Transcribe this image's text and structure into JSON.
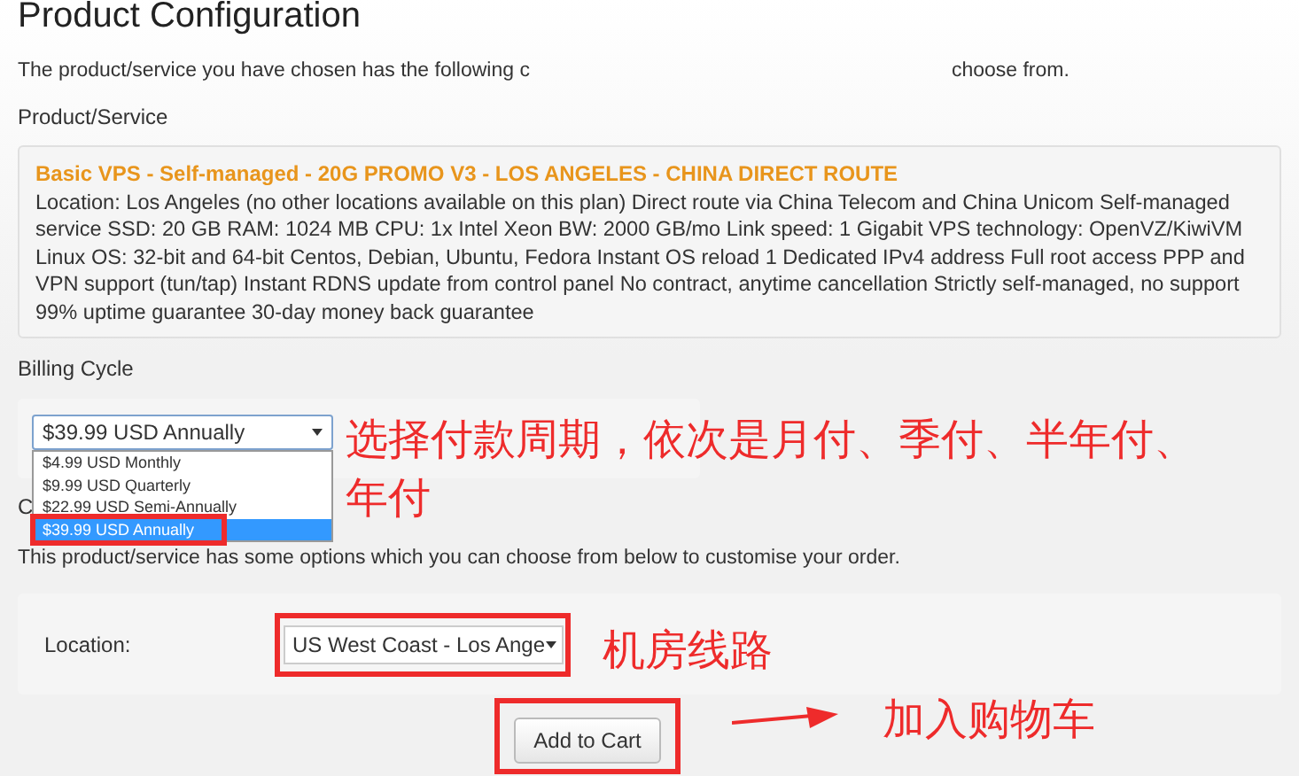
{
  "page_title": "Product Configuration",
  "intro": [
    "The product/service you have chosen has the following c",
    "choose from."
  ],
  "product_section": {
    "label": "Product/Service",
    "name": "Basic VPS - Self-managed - 20G PROMO V3 - LOS ANGELES - CHINA DIRECT ROUTE",
    "description": "Location: Los Angeles (no other locations available on this plan) Direct route via China Telecom and China Unicom Self-managed service SSD: 20 GB RAM: 1024 MB CPU: 1x Intel Xeon BW: 2000 GB/mo Link speed: 1 Gigabit VPS technology: OpenVZ/KiwiVM Linux OS: 32-bit and 64-bit Centos, Debian, Ubuntu, Fedora Instant OS reload 1 Dedicated IPv4 address Full root access PPP and VPN support (tun/tap) Instant RDNS update from control panel No contract, anytime cancellation Strictly self-managed, no support 99% uptime guarantee 30-day money back guarantee"
  },
  "billing": {
    "label": "Billing Cycle",
    "value": "$39.99 USD Annually",
    "options": [
      {
        "label": "$4.99 USD Monthly",
        "selected": false
      },
      {
        "label": "$9.99 USD Quarterly",
        "selected": false
      },
      {
        "label": "$22.99 USD Semi-Annually",
        "selected": false
      },
      {
        "label": "$39.99 USD Annually",
        "selected": true
      }
    ]
  },
  "configurable": {
    "heading": "C",
    "note": "This product/service has some options which you can choose from below to customise your order.",
    "location_label": "Location:",
    "location_value": "US West Coast - Los Ange"
  },
  "add_to_cart": "Add to Cart",
  "annotations": {
    "billing": "选择付款周期，依次是月付、季付、半年付、年付",
    "location": "机房线路",
    "cart": "加入购物车"
  }
}
